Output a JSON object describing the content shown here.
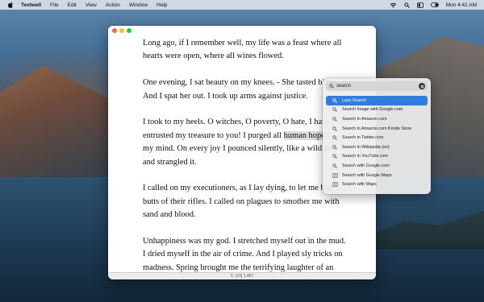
{
  "menubar": {
    "app_name": "Textwell",
    "items": [
      "File",
      "Edit",
      "View",
      "Action",
      "Window",
      "Help"
    ],
    "clock": "Mon 4:41 AM"
  },
  "document": {
    "paragraphs": [
      [
        "Long ago, if I remember well, my life was a feast where all",
        "hearts were open, where all wines flowed."
      ],
      [
        "One evening, I sat beauty on my knees. - She tasted bitte",
        "And I spat her out. I took up arms against justice."
      ],
      [
        "I took to my heels. O witches, O poverty, O hate, I have",
        "my mind. On every joy I pounced silently, like a wild bea",
        "and strangled it."
      ],
      [
        "I called on my executioners, as I lay dying, to let me bite",
        "butts of their rifles. I called on plagues to smother me with",
        "sand and blood."
      ],
      [
        "Unhappiness was my god. I stretched myself out in the mud.",
        "I dried myself in the air of crime. And I played sly tricks on",
        "madness. Spring brought me the terrifying laughter of an"
      ]
    ],
    "p3_line2_before": "entrusted my treasure to you! I purged all ",
    "p3_line2_highlight": "human hope",
    "p3_line2_after": " f"
  },
  "status": "C: [10] 1,457",
  "search": {
    "value": "search",
    "results": [
      {
        "label": "Lazy Search",
        "icon": "search-icon",
        "selected": true
      },
      {
        "label": "Search Image with Google.com",
        "icon": "search-icon"
      },
      {
        "label": "Search in Amazon.com",
        "icon": "search-icon"
      },
      {
        "label": "Search in Amazon.com Kindle Store",
        "icon": "search-icon"
      },
      {
        "label": "Search in Twitter.com",
        "icon": "search-icon"
      },
      {
        "label": "Search in Wikipedia (en)",
        "icon": "search-icon"
      },
      {
        "label": "Search in YouTube.com",
        "icon": "search-icon"
      },
      {
        "label": "Search with Google.com",
        "icon": "search-icon"
      },
      {
        "label": "Search with Google Maps",
        "icon": "map-icon"
      },
      {
        "label": "Search with Maps",
        "icon": "map-icon"
      }
    ]
  },
  "colors": {
    "selection": "#2f7ddc",
    "close": "#ff5f57",
    "minimize": "#febc2e",
    "maximize": "#28c840"
  }
}
